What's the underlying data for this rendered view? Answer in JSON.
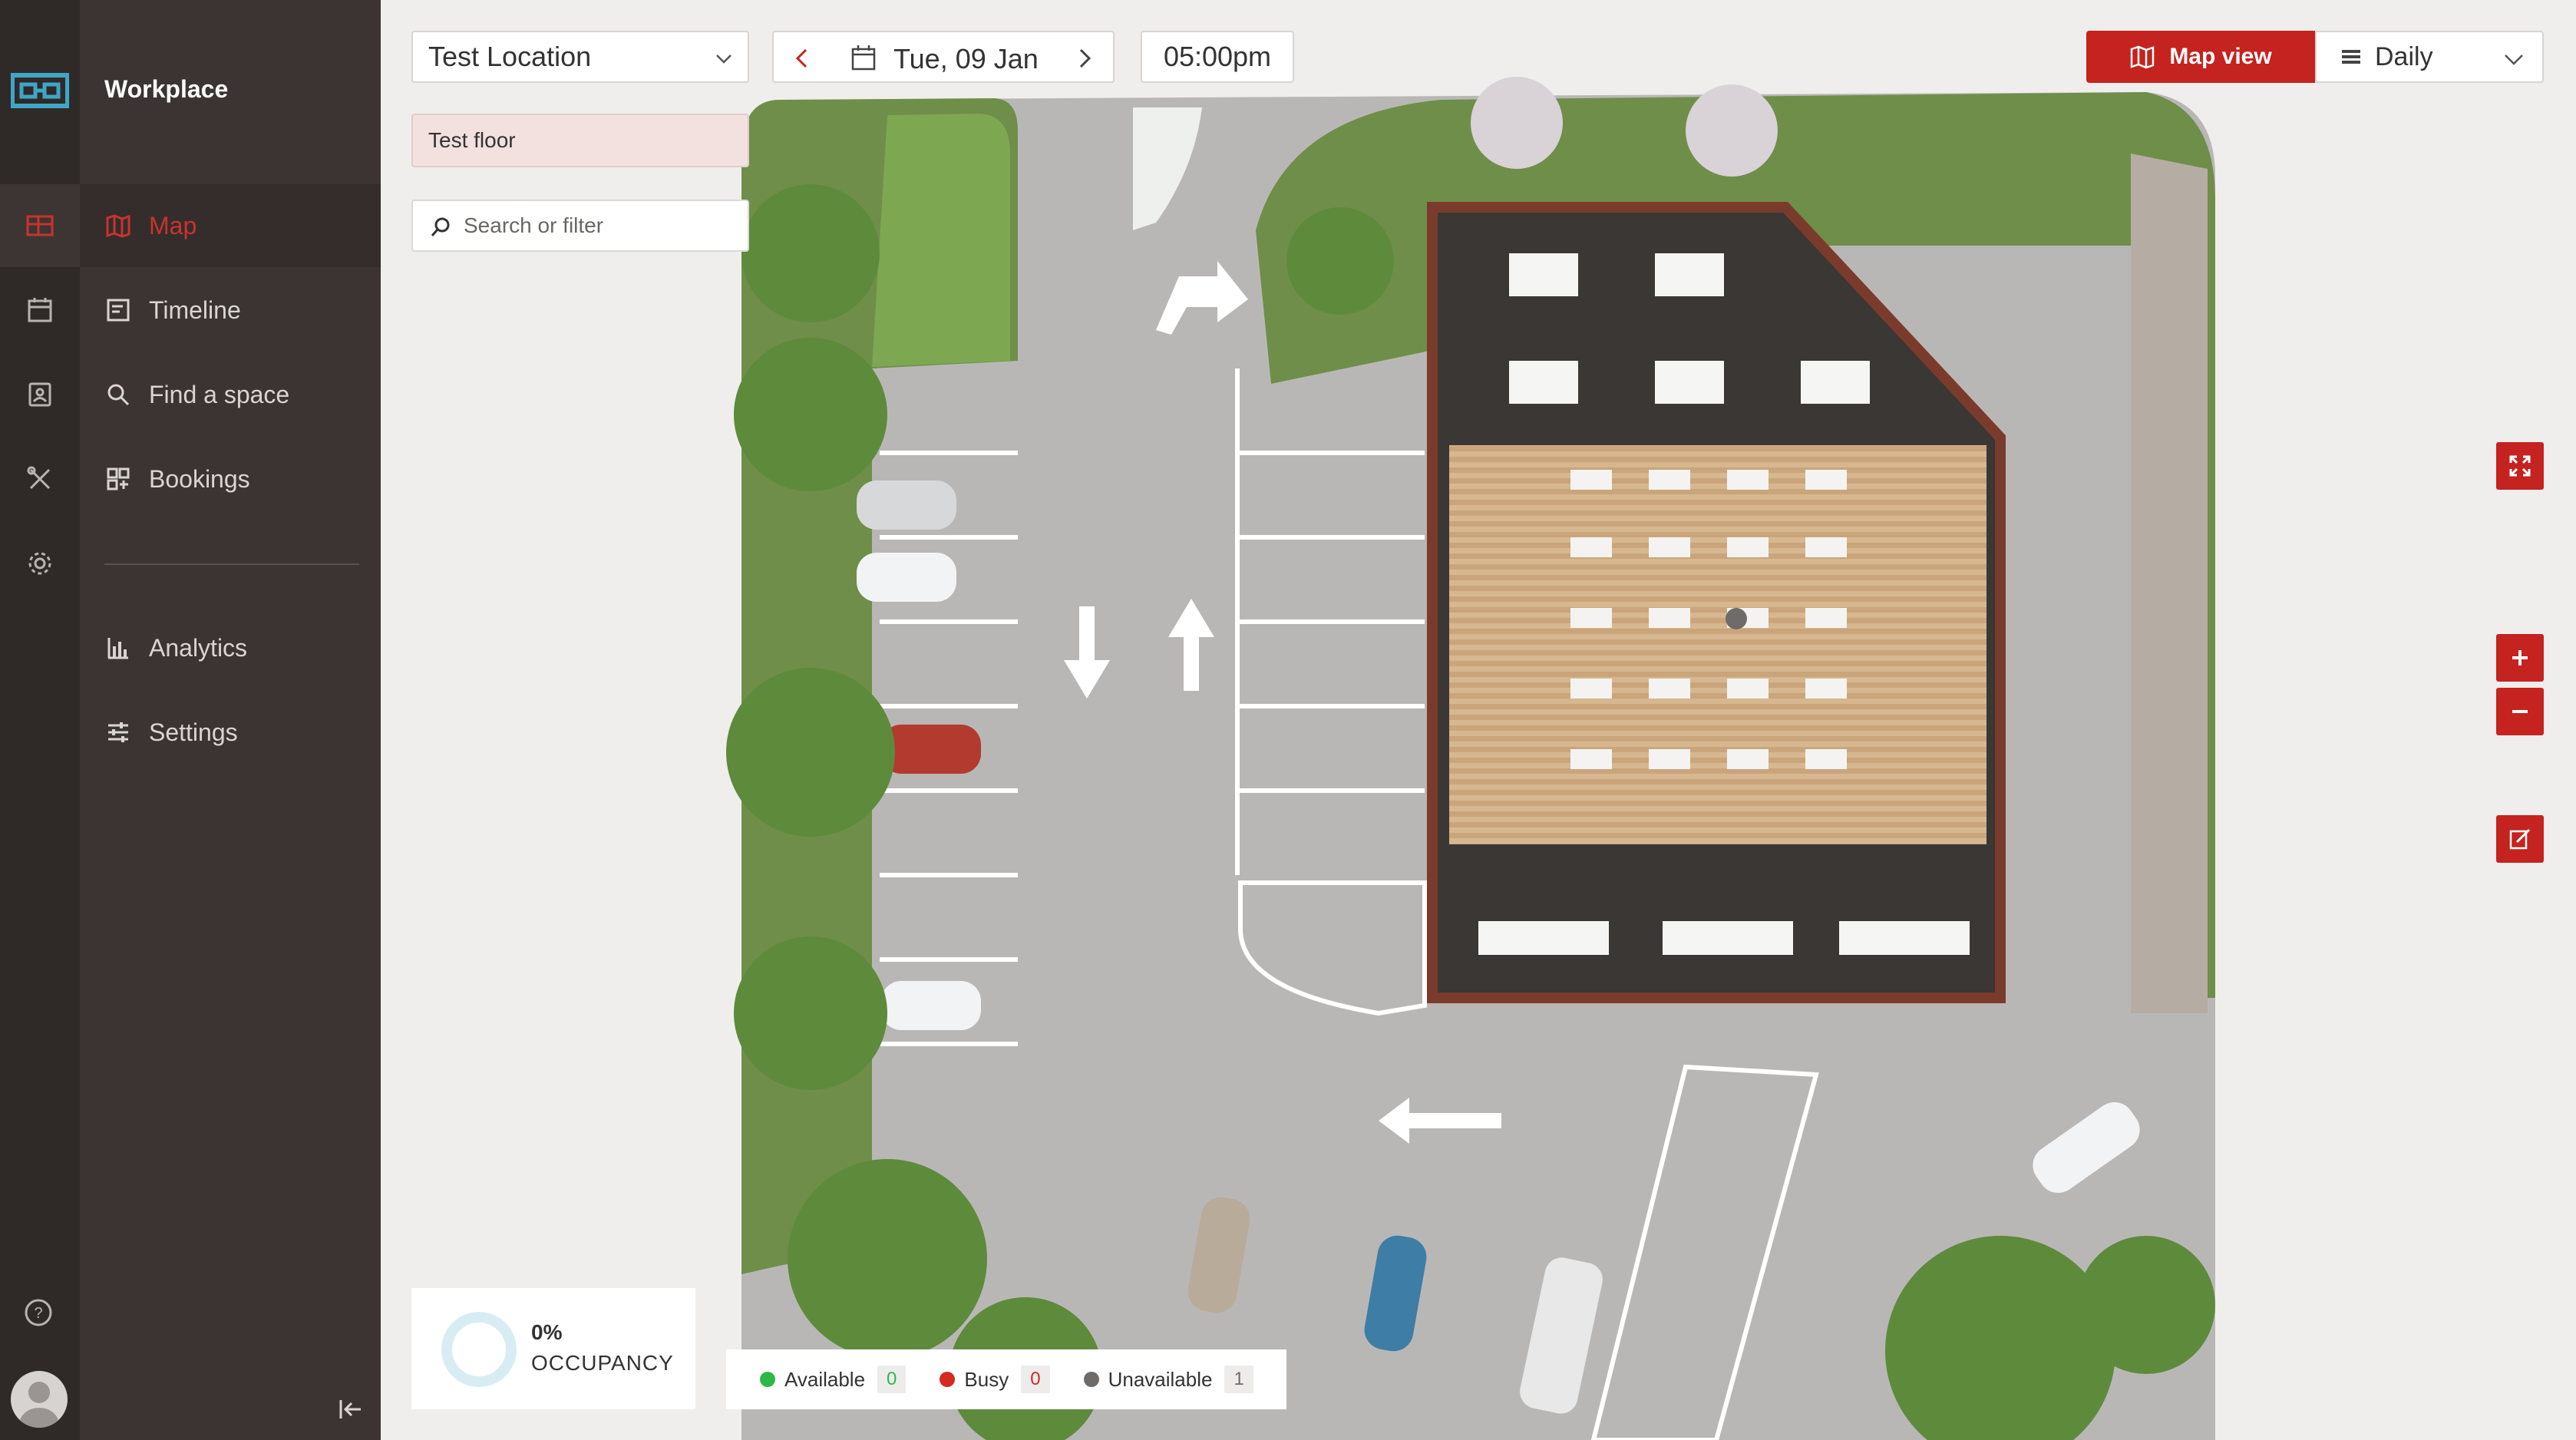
{
  "app": {
    "name": "Workplace"
  },
  "nav": {
    "items": [
      {
        "label": "Map",
        "icon": "map-icon"
      },
      {
        "label": "Timeline",
        "icon": "timeline-icon"
      },
      {
        "label": "Find a space",
        "icon": "search-icon"
      },
      {
        "label": "Bookings",
        "icon": "bookings-icon"
      },
      {
        "label": "Analytics",
        "icon": "analytics-icon"
      },
      {
        "label": "Settings",
        "icon": "sliders-icon"
      }
    ],
    "active": "Map"
  },
  "toolbar": {
    "location": "Test Location",
    "date": "Tue, 09 Jan",
    "time": "05:00pm",
    "map_view_label": "Map view",
    "period": "Daily"
  },
  "floor": {
    "name": "Test floor"
  },
  "search": {
    "placeholder": "Search or filter"
  },
  "occupancy": {
    "percent_label": "0%",
    "label": "OCCUPANCY",
    "value": 0
  },
  "legend": [
    {
      "label": "Available",
      "count": "0",
      "color": "#2fb84a"
    },
    {
      "label": "Busy",
      "count": "0",
      "color": "#d32a24"
    },
    {
      "label": "Unavailable",
      "count": "1",
      "color": "#6f6b69"
    }
  ],
  "colors": {
    "accent": "#c4231f",
    "sidebar": "#2f2a28",
    "nav": "#3b3432"
  }
}
